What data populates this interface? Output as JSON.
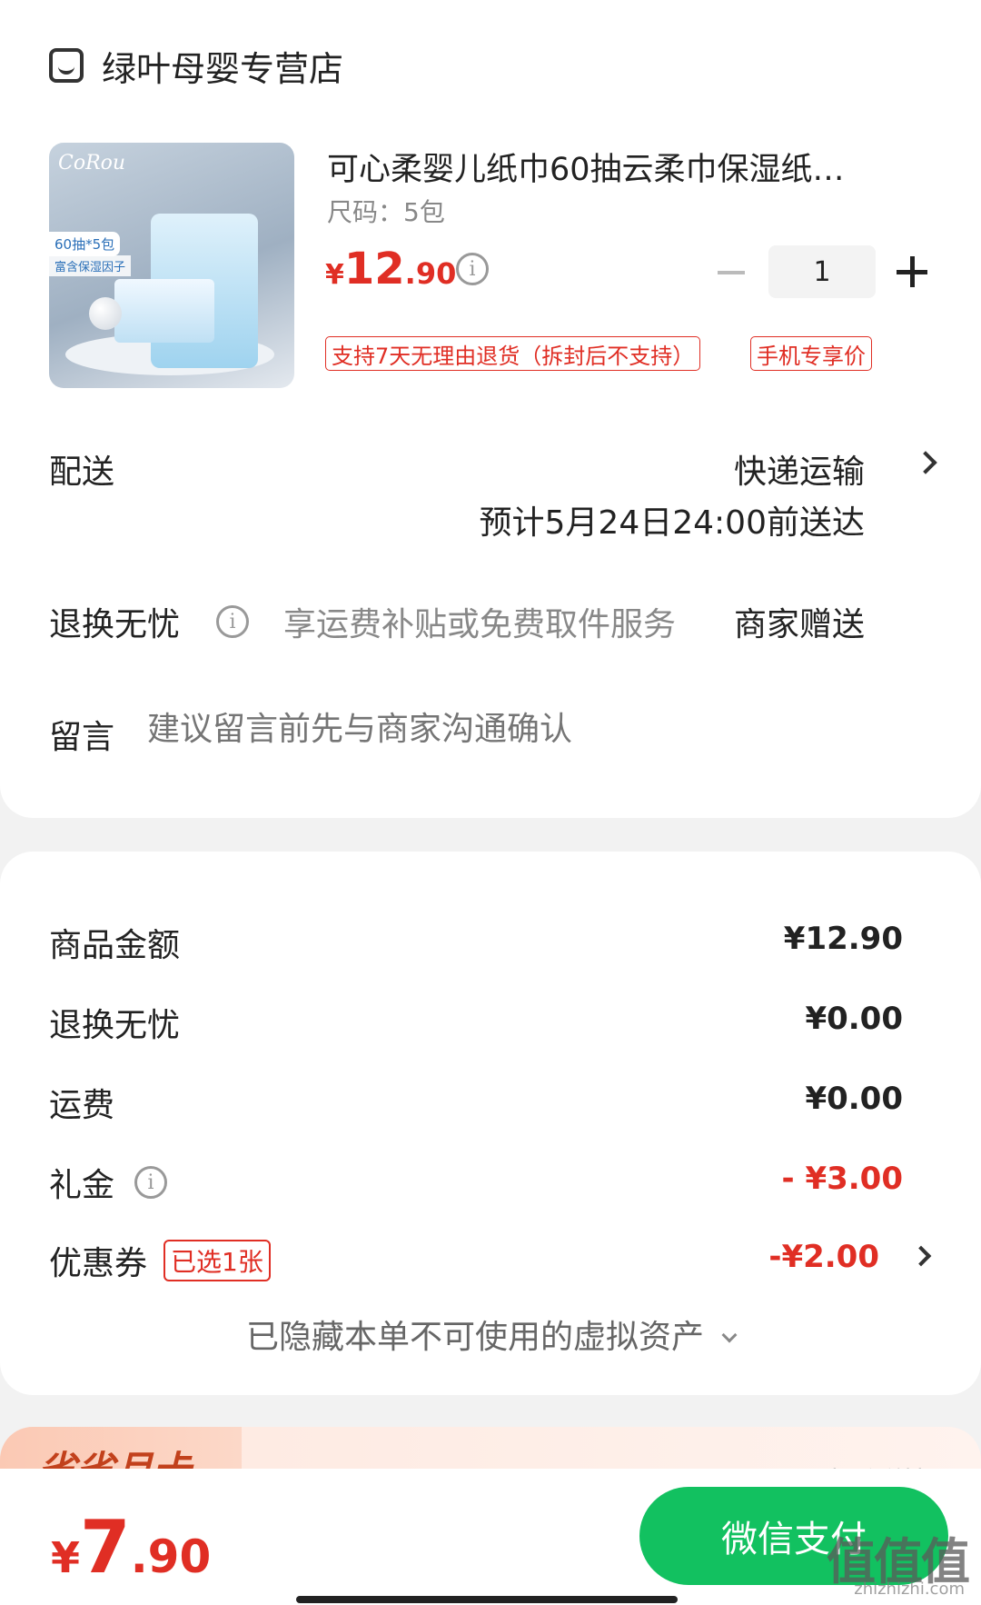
{
  "store": {
    "name": "绿叶母婴专营店",
    "icon": "store-icon"
  },
  "product": {
    "image_brand": "CoRou",
    "image_tag1": "60抽*5包",
    "image_tag2": "富含保湿因子",
    "title": "可心柔婴儿纸巾60抽云柔巾保湿纸…",
    "spec": "尺码：5包",
    "price_currency": "¥",
    "price_int": "12",
    "price_dec": ".90",
    "quantity": "1",
    "badges": [
      "支持7天无理由退货（拆封后不支持）",
      "手机专享价"
    ]
  },
  "delivery": {
    "label": "配送",
    "method": "快递运输",
    "eta": "预计5月24日24:00前送达"
  },
  "return_service": {
    "label": "退换无忧",
    "desc": "享运费补贴或免费取件服务",
    "gift": "商家赠送"
  },
  "note": {
    "label": "留言",
    "placeholder": "建议留言前先与商家沟通确认"
  },
  "fees": {
    "goods_label": "商品金额",
    "goods_value": "¥12.90",
    "return_label": "退换无忧",
    "return_value": "¥0.00",
    "shipping_label": "运费",
    "shipping_value": "¥0.00",
    "gift_label": "礼金",
    "gift_value": "- ¥3.00",
    "coupon_label": "优惠券",
    "coupon_tag": "已选1张",
    "coupon_value": "-¥2.00",
    "hidden_assets": "已隐藏本单不可使用的虚拟资产"
  },
  "promo": {
    "title": "省省月卡",
    "link": "查看详情"
  },
  "checkout": {
    "total_currency": "¥",
    "total_int": "7",
    "total_dec": ".90",
    "pay_label": "微信支付"
  },
  "watermark": {
    "text": "值值值",
    "sub": "zhizhizhi.com"
  },
  "colors": {
    "accent_red": "#e02e24",
    "pay_green": "#12c160"
  }
}
